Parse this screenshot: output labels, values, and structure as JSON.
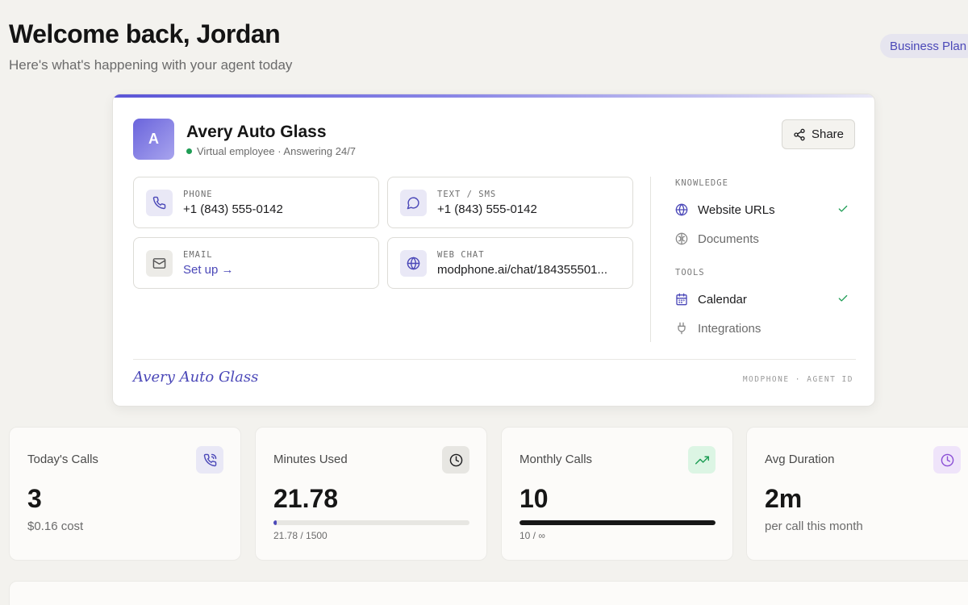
{
  "header": {
    "title": "Welcome back, Jordan",
    "subtitle": "Here's what's happening with your agent today",
    "plan_badge": "Business Plan"
  },
  "agent": {
    "avatar_letter": "A",
    "name": "Avery Auto Glass",
    "status": "Virtual employee · Answering 24/7",
    "share_label": "Share",
    "signature": "Avery Auto Glass",
    "agent_id_label": "MODPHONE · AGENT ID",
    "colors": {
      "accent": "#4b48b8",
      "status_dot": "#1f9d55"
    },
    "channels": [
      {
        "label": "PHONE",
        "value": "+1 (843) 555-0142",
        "icon": "phone-icon"
      },
      {
        "label": "TEXT / SMS",
        "value": "+1 (843) 555-0142",
        "icon": "chat-bubble-icon"
      },
      {
        "label": "EMAIL",
        "value": "Set up →",
        "icon": "mail-icon"
      },
      {
        "label": "WEB CHAT",
        "value": "modphone.ai/chat/184355501...",
        "icon": "globe-icon"
      }
    ],
    "knowledge": {
      "label": "KNOWLEDGE",
      "items": [
        {
          "label": "Website URLs",
          "icon": "globe-icon",
          "enabled": true
        },
        {
          "label": "Documents",
          "icon": "brain-icon",
          "enabled": false
        }
      ]
    },
    "tools": {
      "label": "TOOLS",
      "items": [
        {
          "label": "Calendar",
          "icon": "calendar-icon",
          "enabled": true
        },
        {
          "label": "Integrations",
          "icon": "plug-icon",
          "enabled": false
        }
      ]
    }
  },
  "stats": [
    {
      "title": "Today's Calls",
      "value": "3",
      "sub": "$0.16 cost",
      "icon": "phone-call-icon"
    },
    {
      "title": "Minutes Used",
      "value": "21.78",
      "bar_sub": "21.78 / 1500",
      "progress": 0.0145,
      "icon": "clock-icon"
    },
    {
      "title": "Monthly Calls",
      "value": "10",
      "bar_sub": "10 / ∞",
      "progress": 1.0,
      "icon": "trending-up-icon"
    },
    {
      "title": "Avg Duration",
      "value": "2m",
      "sub": "per call this month",
      "icon": "clock-icon"
    }
  ]
}
